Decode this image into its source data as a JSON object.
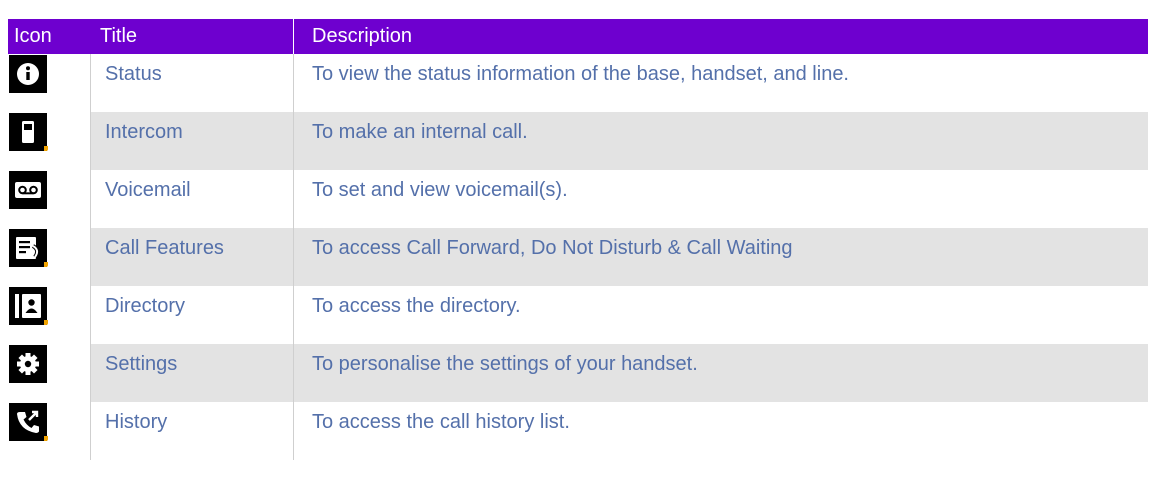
{
  "header": {
    "icon": "Icon",
    "title": "Title",
    "description": "Description"
  },
  "colors": {
    "header_bg": "#6e00cf",
    "text": "#5470aa",
    "shade": "#e3e3e3"
  },
  "rows": [
    {
      "icon": "info-icon",
      "title": "Status",
      "description": "To view the status information of the base, handset, and line."
    },
    {
      "icon": "handset-icon",
      "title": "Intercom",
      "description": "To make an internal call."
    },
    {
      "icon": "voicemail-icon",
      "title": "Voicemail",
      "description": "To set and view voicemail(s)."
    },
    {
      "icon": "call-features-icon",
      "title": "Call Features",
      "description": "To access Call Forward, Do Not Disturb & Call Waiting"
    },
    {
      "icon": "directory-icon",
      "title": "Directory",
      "description": "To access the directory."
    },
    {
      "icon": "gear-icon",
      "title": "Settings",
      "description": "To personalise the settings of your handset."
    },
    {
      "icon": "call-history-icon",
      "title": "History",
      "description": "To access the call history list."
    }
  ]
}
